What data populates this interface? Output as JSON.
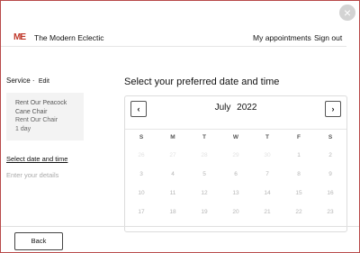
{
  "header": {
    "logo_text": "ME",
    "brand": "The Modern Eclectic",
    "nav": [
      "My appointments",
      "Sign out"
    ]
  },
  "sidebar": {
    "service_label": "Service",
    "edit_label": "Edit",
    "service_name": "Rent Our Peacock Cane Chair",
    "service_category": "Rent Our Chair",
    "service_duration": "1 day",
    "step_current": "Select date and time",
    "step_next": "Enter your details"
  },
  "main": {
    "title": "Select your preferred date and time"
  },
  "calendar": {
    "month": "July",
    "year": "2022",
    "prev_icon": "‹",
    "next_icon": "›",
    "weekdays": [
      "S",
      "M",
      "T",
      "W",
      "T",
      "F",
      "S"
    ],
    "weeks": [
      [
        "26",
        "27",
        "28",
        "29",
        "30",
        "1",
        "2"
      ],
      [
        "3",
        "4",
        "5",
        "6",
        "7",
        "8",
        "9"
      ],
      [
        "10",
        "11",
        "12",
        "13",
        "14",
        "15",
        "16"
      ],
      [
        "17",
        "18",
        "19",
        "20",
        "21",
        "22",
        "23"
      ]
    ],
    "faint_cells": [
      [
        0,
        0
      ],
      [
        0,
        1
      ],
      [
        0,
        2
      ],
      [
        0,
        3
      ],
      [
        0,
        4
      ]
    ]
  },
  "footer": {
    "back_label": "Back"
  },
  "close_icon": "×"
}
